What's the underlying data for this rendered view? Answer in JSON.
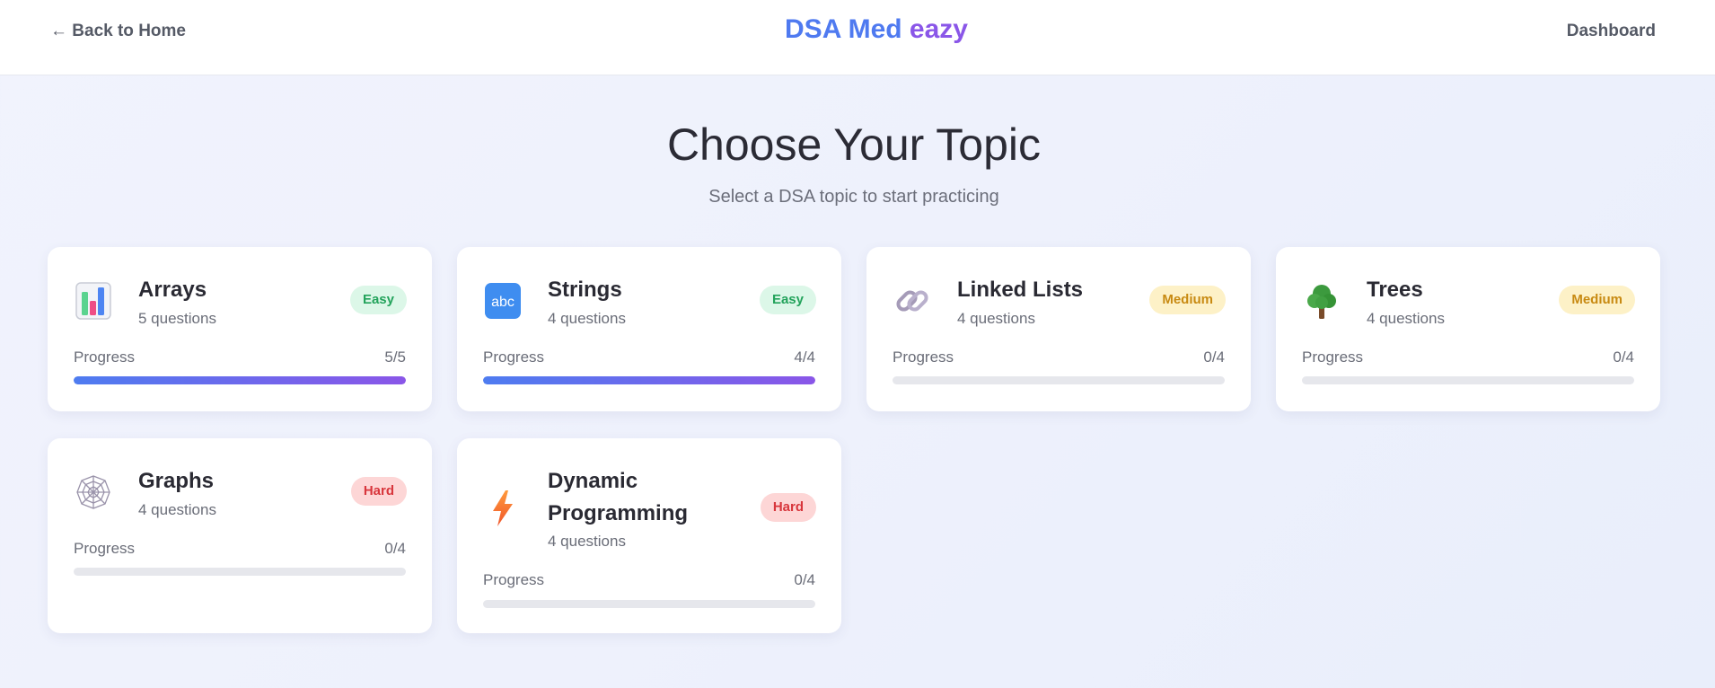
{
  "header": {
    "back_label": "← Back to Home",
    "brand_part1": "DSA Med",
    "brand_part2": "eazy",
    "dashboard_label": "Dashboard"
  },
  "main": {
    "title": "Choose Your Topic",
    "subtitle": "Select a DSA topic to start practicing",
    "progress_label": "Progress"
  },
  "topics": [
    {
      "name": "Arrays",
      "questions": "5 questions",
      "difficulty": "Easy",
      "progress_text": "5/5",
      "progress_fraction": 1.0,
      "icon": "bar-chart-icon"
    },
    {
      "name": "Strings",
      "questions": "4 questions",
      "difficulty": "Easy",
      "progress_text": "4/4",
      "progress_fraction": 1.0,
      "icon": "abc-icon"
    },
    {
      "name": "Linked Lists",
      "questions": "4 questions",
      "difficulty": "Medium",
      "progress_text": "0/4",
      "progress_fraction": 0.0,
      "icon": "chain-link-icon"
    },
    {
      "name": "Trees",
      "questions": "4 questions",
      "difficulty": "Medium",
      "progress_text": "0/4",
      "progress_fraction": 0.0,
      "icon": "tree-icon"
    },
    {
      "name": "Graphs",
      "questions": "4 questions",
      "difficulty": "Hard",
      "progress_text": "0/4",
      "progress_fraction": 0.0,
      "icon": "spider-web-icon"
    },
    {
      "name": "Dynamic Programming",
      "questions": "4 questions",
      "difficulty": "Hard",
      "progress_text": "0/4",
      "progress_fraction": 0.0,
      "icon": "lightning-icon"
    }
  ],
  "colors": {
    "accent_blue": "#4f7af0",
    "accent_purple": "#8a56e8",
    "easy": "#23a35b",
    "medium": "#c88a12",
    "hard": "#d8363c"
  }
}
